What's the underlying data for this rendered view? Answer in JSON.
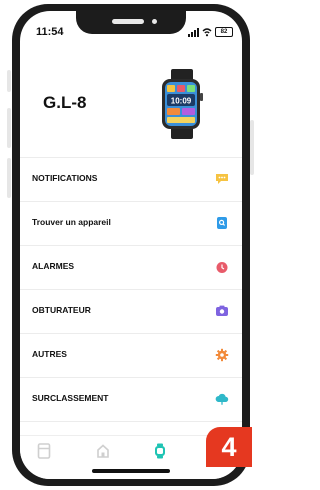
{
  "status_bar": {
    "time": "11:54",
    "battery": "82"
  },
  "device": {
    "name": "G.L-8",
    "watch_time": "10:09"
  },
  "menu": {
    "items": [
      {
        "label": "NOTIFICATIONS",
        "icon": "chat-bubble-icon",
        "color": "#f6c342"
      },
      {
        "label": "Trouver un appareil",
        "icon": "search-device-icon",
        "color": "#2f9be8"
      },
      {
        "label": "ALARMES",
        "icon": "alarm-clock-icon",
        "color": "#e85b6a"
      },
      {
        "label": "OBTURATEUR",
        "icon": "camera-icon",
        "color": "#7e63e0"
      },
      {
        "label": "AUTRES",
        "icon": "gear-icon",
        "color": "#f28a3a"
      },
      {
        "label": "SURCLASSEMENT",
        "icon": "cloud-upload-icon",
        "color": "#2fb8c9"
      }
    ]
  },
  "tabbar": {
    "tabs": [
      {
        "icon": "device-tab-icon",
        "active": false
      },
      {
        "icon": "home-tab-icon",
        "active": false
      },
      {
        "icon": "watch-tab-icon",
        "active": true
      }
    ],
    "active_color": "#1fc4b4",
    "inactive_color": "#cfcfcf"
  },
  "step_badge": "4"
}
